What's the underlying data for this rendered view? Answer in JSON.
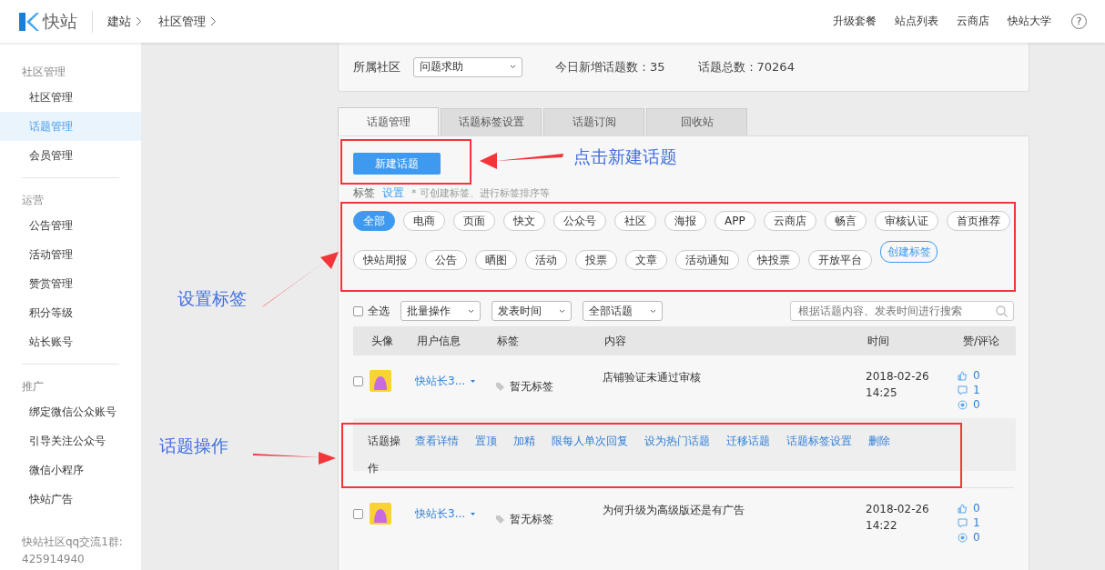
{
  "header": {
    "logo": "快站",
    "breadcrumbs": [
      "建站",
      "社区管理"
    ],
    "nav": [
      "升级套餐",
      "站点列表",
      "云商店",
      "快站大学"
    ],
    "help": "?"
  },
  "sidebar": {
    "sections": [
      {
        "title": "社区管理",
        "items": [
          {
            "label": "社区管理",
            "selected": false
          },
          {
            "label": "话题管理",
            "selected": true
          },
          {
            "label": "会员管理",
            "selected": false
          }
        ]
      },
      {
        "title": "运营",
        "items": [
          {
            "label": "公告管理",
            "selected": false
          },
          {
            "label": "活动管理",
            "selected": false
          },
          {
            "label": "赞赏管理",
            "selected": false
          },
          {
            "label": "积分等级",
            "selected": false
          },
          {
            "label": "站长账号",
            "selected": false
          }
        ]
      },
      {
        "title": "推广",
        "items": [
          {
            "label": "绑定微信公众账号",
            "selected": false
          },
          {
            "label": "引导关注公众号",
            "selected": false
          },
          {
            "label": "微信小程序",
            "selected": false
          },
          {
            "label": "快站广告",
            "selected": false
          }
        ]
      }
    ],
    "footer": [
      "快站社区qq交流1群:",
      "425914940"
    ]
  },
  "summary": {
    "community_label": "所属社区",
    "community": "问题求助",
    "today": "今日新增话题数：35",
    "total": "话题总数：70264"
  },
  "tabs": [
    {
      "label": "话题管理",
      "selected": true
    },
    {
      "label": "话题标签设置",
      "selected": false
    },
    {
      "label": "话题订阅",
      "selected": false
    },
    {
      "label": "回收站",
      "selected": false
    }
  ],
  "new_button": "新建话题",
  "tag_hint": {
    "label": "标签",
    "link": "设置",
    "note": "* 可创建标签、进行标签排序等"
  },
  "tags": [
    {
      "label": "全部",
      "selected": true
    },
    {
      "label": "电商",
      "selected": false
    },
    {
      "label": "页面",
      "selected": false
    },
    {
      "label": "快文",
      "selected": false
    },
    {
      "label": "公众号",
      "selected": false
    },
    {
      "label": "社区",
      "selected": false
    },
    {
      "label": "海报",
      "selected": false
    },
    {
      "label": "APP",
      "selected": false
    },
    {
      "label": "云商店",
      "selected": false
    },
    {
      "label": "畅言",
      "selected": false
    },
    {
      "label": "审核认证",
      "selected": false
    },
    {
      "label": "首页推荐",
      "selected": false
    },
    {
      "label": "快站周报",
      "selected": false
    },
    {
      "label": "公告",
      "selected": false
    },
    {
      "label": "晒图",
      "selected": false
    },
    {
      "label": "活动",
      "selected": false
    },
    {
      "label": "投票",
      "selected": false
    },
    {
      "label": "文章",
      "selected": false
    },
    {
      "label": "活动通知",
      "selected": false
    },
    {
      "label": "快投票",
      "selected": false
    },
    {
      "label": "开放平台",
      "selected": false
    }
  ],
  "create_tag": "创建标签",
  "filters": {
    "select_all": {
      "label": "全选",
      "checked": false
    },
    "selects": [
      "批量操作",
      "发表时间",
      "全部话题"
    ],
    "search": {
      "placeholder": "根据话题内容、发表时间进行搜索"
    }
  },
  "table": {
    "columns": [
      "头像",
      "用户信息",
      "标签",
      "内容",
      "时间",
      "赞/评论"
    ],
    "rows": [
      {
        "checked": false,
        "user": "快站长3...",
        "tag": "暂无标签",
        "content": "店铺验证未通过审核",
        "time": "2018-02-26 14:25",
        "likes": "0",
        "comments": "1",
        "rewards": "0",
        "actions": {
          "label": "话题操作",
          "links": [
            "查看详情",
            "置顶",
            "加精",
            "限每人单次回复",
            "设为热门话题",
            "迁移话题",
            "话题标签设置",
            "删除"
          ]
        }
      },
      {
        "checked": false,
        "user": "快站长3...",
        "tag": "暂无标签",
        "content": "为何升级为高级版还是有广告",
        "time": "2018-02-26 14:22",
        "likes": "0",
        "comments": "1",
        "rewards": "0"
      }
    ]
  },
  "annotations": [
    "点击新建话题",
    "设置标签",
    "话题操作"
  ]
}
